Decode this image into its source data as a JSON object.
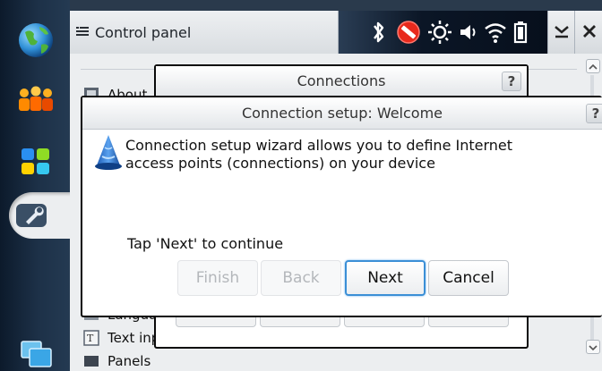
{
  "window": {
    "title": "Control panel"
  },
  "status_icons": [
    "bluetooth-icon",
    "presence-busy-icon",
    "brightness-icon",
    "volume-icon",
    "wifi-icon",
    "battery-icon"
  ],
  "control_panel": {
    "items": [
      {
        "label": "About",
        "icon": "about-icon"
      },
      {
        "label": "Language",
        "icon": "language-icon"
      },
      {
        "label": "Text input",
        "icon": "text-input-icon"
      },
      {
        "label": "Panels",
        "icon": "panels-icon"
      }
    ]
  },
  "connections_dialog": {
    "title": "Connections",
    "help": "?"
  },
  "setup_dialog": {
    "title": "Connection setup: Welcome",
    "help": "?",
    "description": "Connection setup wizard allows you to define Internet access points (connections) on your device",
    "instruction": "Tap 'Next' to continue",
    "buttons": {
      "finish": "Finish",
      "back": "Back",
      "next": "Next",
      "cancel": "Cancel"
    }
  }
}
